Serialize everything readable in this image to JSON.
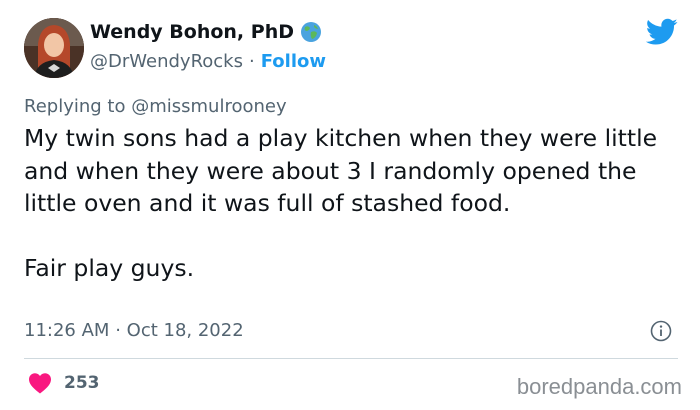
{
  "author": {
    "display_name": "Wendy Bohon, PhD",
    "handle": "@DrWendyRocks",
    "separator": "·",
    "follow_label": "Follow",
    "badge_icon": "globe-icon"
  },
  "reply": {
    "prefix": "Replying to",
    "mention": "@missmulrooney"
  },
  "tweet": {
    "paragraph1": "My twin sons had a play kitchen when they were little and when they were about 3 I randomly opened the little oven and it was full of stashed food.",
    "paragraph2": "Fair play guys.",
    "time": "11:26 AM",
    "separator": "·",
    "date": "Oct 18, 2022"
  },
  "engagement": {
    "likes": "253"
  },
  "watermark": "boredpanda.com",
  "colors": {
    "accent": "#1d9bf0",
    "heart": "#f91880",
    "text": "#0f1419",
    "muted": "#536471",
    "divider": "#cfd9de"
  },
  "icons": [
    "twitter-bird-icon",
    "info-icon",
    "heart-icon",
    "globe-icon"
  ]
}
